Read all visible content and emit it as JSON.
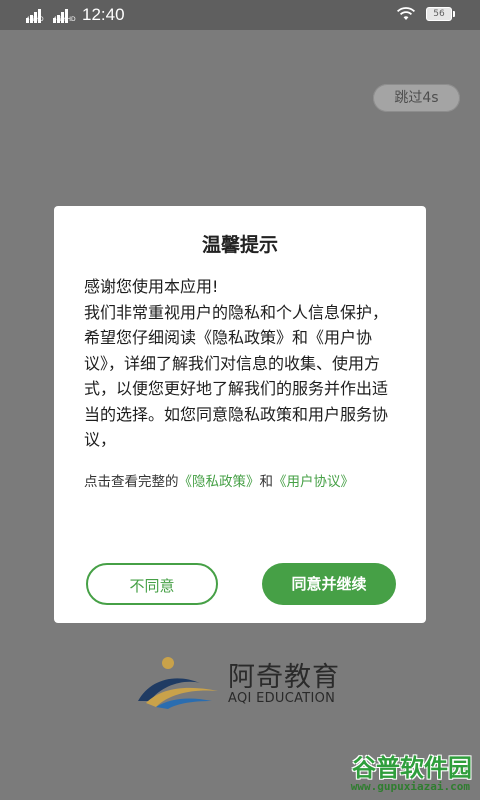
{
  "status_bar": {
    "signal_1_label": "4GHD",
    "signal_2_label": "4G+HD",
    "time": "12:40",
    "battery": "56",
    "icons": [
      "signal-icon",
      "wifi-icon",
      "battery-icon"
    ]
  },
  "splash": {
    "skip_label": "跳过4s",
    "logo_cn": "阿奇教育",
    "logo_en": "AQI EDUCATION"
  },
  "dialog": {
    "title": "温馨提示",
    "body_lines": [
      "感谢您使用本应用!",
      "我们非常重视用户的隐私和个人信息保护，希望您仔细阅读《隐私政策》和《用户协议》，详细了解我们对信息的收集、使用方式，以便您更好地了解我们的服务并作出适当的选择。如您同意隐私政策和用户服务协议，"
    ],
    "links_prefix": "点击查看完整的",
    "privacy_link": "《隐私政策》",
    "links_conjunction": "和",
    "user_agreement_link": "《用户协议》",
    "disagree_label": "不同意",
    "agree_label": "同意并继续"
  },
  "watermark": {
    "cn": "谷普软件园",
    "url": "www.gupuxiazai.com"
  },
  "colors": {
    "accent_green": "#46a046",
    "overlay_gray": "#7b7b7b",
    "status_bar": "#5f5f5f"
  }
}
